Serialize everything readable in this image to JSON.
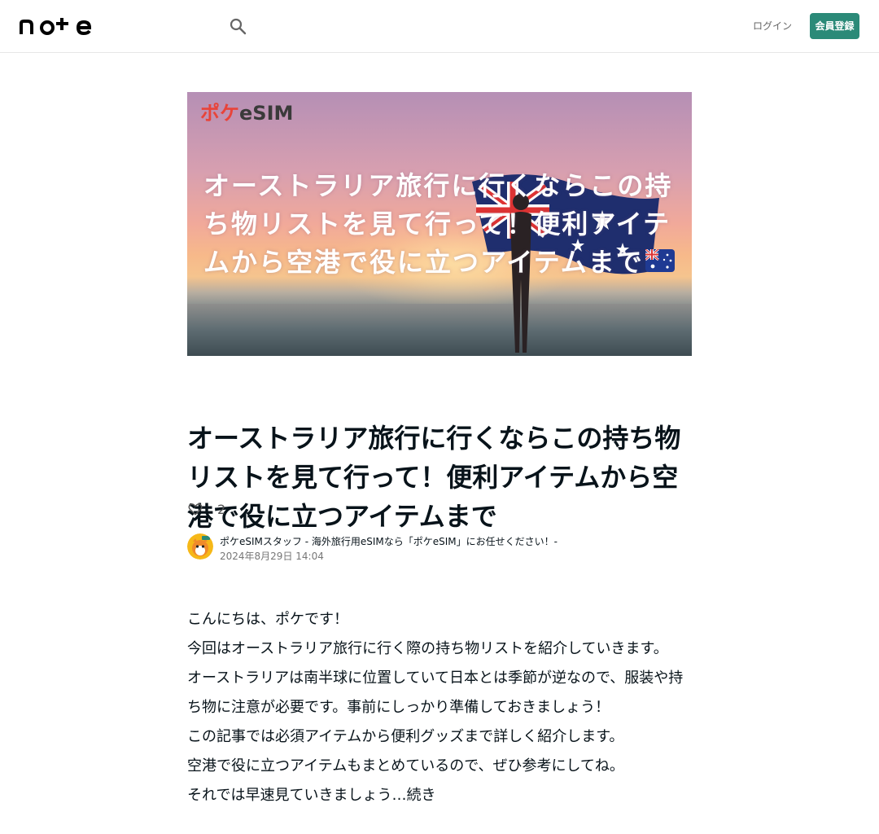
{
  "header": {
    "logo_text": "note",
    "login_label": "ログイン",
    "signup_label": "会員登録"
  },
  "hero": {
    "brand_poke": "ポケ",
    "brand_esim": "eSIM",
    "banner_text": "オーストラリア旅行に行くならこの持ち物リストを見て行って！便利アイテムから空港で役に立つアイテムまで"
  },
  "article": {
    "title": "オーストラリア旅行に行くならこの持ち物リストを見て行って！便利アイテムから空港で役に立つアイテムまで",
    "like_count": "2",
    "author_name": "ポケeSIMスタッフ - 海外旅行用eSIMなら「ポケeSIM」にお任せください！-",
    "post_date": "2024年8月29日 14:04",
    "paragraphs": [
      "こんにちは、ポケです！",
      "今回はオーストラリア旅行に行く際の持ち物リストを紹介していきます。",
      "オーストラリアは南半球に位置していて日本とは季節が逆なので、服装や持ち物に注意が必要です。事前にしっかり準備しておきましょう！",
      "この記事では必須アイテムから便利グッズまで詳しく紹介します。",
      "空港で役に立つアイテムもまとめているので、ぜひ参考にしてね。",
      "それでは早速見ていきましょう…続き"
    ]
  }
}
